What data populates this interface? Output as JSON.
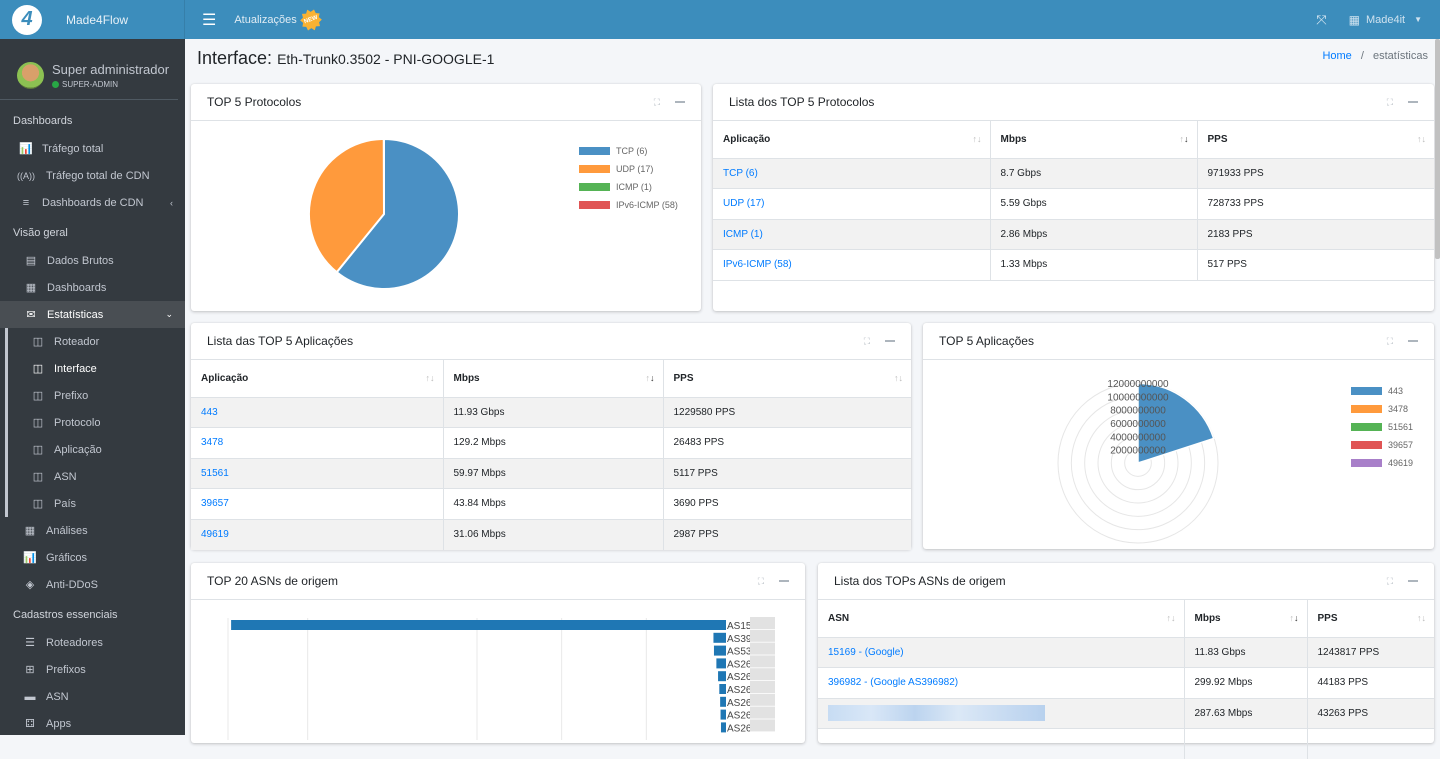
{
  "topbar": {
    "brand_name": "Made4Flow",
    "logo_glyph": "4",
    "menu_icon": "☰",
    "updates_label": "Atualizações",
    "new_badge": "NEW",
    "fullscreen_icon": "⤧",
    "org_icon": "▦",
    "org_name": "Made4it",
    "caret": "▼"
  },
  "user": {
    "name": "Super administrador",
    "role": "SUPER-ADMIN"
  },
  "sidebar": {
    "sections": [
      {
        "header": "Dashboards",
        "items": [
          {
            "label": "Tráfego total",
            "icon": "📊"
          },
          {
            "label": "Tráfego total de CDN",
            "icon": "((A))"
          },
          {
            "label": "Dashboards de CDN",
            "icon": "≡",
            "chevron": "‹"
          }
        ]
      },
      {
        "header": "Visão geral",
        "items": [
          {
            "label": "Dados Brutos",
            "icon": "▤"
          },
          {
            "label": "Dashboards",
            "icon": "▦"
          },
          {
            "label": "Estatísticas",
            "icon": "✉",
            "chevron": "⌄"
          }
        ]
      }
    ],
    "sub_items": [
      "Roteador",
      "Interface",
      "Prefixo",
      "Protocolo",
      "Aplicação",
      "ASN",
      "País"
    ],
    "after_items": [
      {
        "label": "Análises",
        "icon": "▦"
      },
      {
        "label": "Gráficos",
        "icon": "📊"
      },
      {
        "label": "Anti-DDoS",
        "icon": "◈"
      }
    ],
    "section3": {
      "header": "Cadastros essenciais",
      "items": [
        {
          "label": "Roteadores",
          "icon": "☰"
        },
        {
          "label": "Prefixos",
          "icon": "⊞"
        },
        {
          "label": "ASN",
          "icon": "▬"
        },
        {
          "label": "Apps",
          "icon": "⚃"
        }
      ]
    }
  },
  "page": {
    "title_prefix": "Interface:",
    "title_value": "Eth-Trunk0.3502 - PNI-GOOGLE-1",
    "breadcrumb_home": "Home",
    "breadcrumb_sep": "/",
    "breadcrumb_current": "estatísticas"
  },
  "cards": {
    "top5_protocols": {
      "title": "TOP 5 Protocolos"
    },
    "list_protocols": {
      "title": "Lista dos TOP 5 Protocolos",
      "headers": [
        "Aplicação",
        "Mbps",
        "PPS"
      ],
      "rows": [
        [
          "TCP (6)",
          "8.7 Gbps",
          "971933 PPS"
        ],
        [
          "UDP (17)",
          "5.59 Gbps",
          "728733 PPS"
        ],
        [
          "ICMP (1)",
          "2.86 Mbps",
          "2183 PPS"
        ],
        [
          "IPv6-ICMP (58)",
          "1.33 Mbps",
          "517 PPS"
        ]
      ]
    },
    "list_apps": {
      "title": "Lista das TOP 5 Aplicações",
      "headers": [
        "Aplicação",
        "Mbps",
        "PPS"
      ],
      "rows": [
        [
          "443",
          "11.93 Gbps",
          "1229580 PPS"
        ],
        [
          "3478",
          "129.2 Mbps",
          "26483 PPS"
        ],
        [
          "51561",
          "59.97 Mbps",
          "5117 PPS"
        ],
        [
          "39657",
          "43.84 Mbps",
          "3690 PPS"
        ],
        [
          "49619",
          "31.06 Mbps",
          "2987 PPS"
        ]
      ]
    },
    "top5_apps": {
      "title": "TOP 5 Aplicações"
    },
    "top20_asn": {
      "title": "TOP 20 ASNs de origem"
    },
    "list_asn": {
      "title": "Lista dos TOPs ASNs de origem",
      "headers": [
        "ASN",
        "Mbps",
        "PPS"
      ],
      "rows": [
        [
          "15169 - (Google)",
          "11.83 Gbps",
          "1243817 PPS"
        ],
        [
          "396982 - (Google AS396982)",
          "299.92 Mbps",
          "44183 PPS"
        ],
        [
          "",
          "287.63 Mbps",
          "43263 PPS"
        ]
      ]
    }
  },
  "chart_data": [
    {
      "type": "pie",
      "title": "TOP 5 Protocolos",
      "categories": [
        "TCP (6)",
        "UDP (17)",
        "ICMP (1)",
        "IPv6-ICMP (58)"
      ],
      "values": [
        8700,
        5590,
        2.86,
        1.33
      ],
      "colors": [
        "#4a90c4",
        "#ff9a3c",
        "#55b355",
        "#e05555"
      ],
      "legend": "top-right"
    },
    {
      "type": "polar-area",
      "title": "TOP 5 Aplicações",
      "categories": [
        "443",
        "3478",
        "51561",
        "39657",
        "49619"
      ],
      "values": [
        11930000000,
        129200000,
        59970000,
        43840000,
        31060000
      ],
      "colors": [
        "#4a90c4",
        "#ff9a3c",
        "#55b355",
        "#e05555",
        "#a87fc9"
      ],
      "radial_ticks": [
        2000000000,
        4000000000,
        6000000000,
        8000000000,
        10000000000,
        12000000000
      ],
      "rlim": [
        0,
        12000000000
      ],
      "legend": "top-right"
    },
    {
      "type": "bar",
      "orientation": "horizontal-reversed",
      "title": "TOP 20 ASNs de origem",
      "categories": [
        "AS15",
        "AS39",
        "AS53",
        "AS26",
        "AS26",
        "AS26",
        "AS26",
        "AS26",
        "AS26"
      ],
      "values": [
        11830,
        299.92,
        287.63,
        230,
        190,
        160,
        140,
        130,
        120
      ],
      "color": "#1f77b4",
      "xlim": [
        0,
        12000
      ],
      "grid": true
    }
  ]
}
